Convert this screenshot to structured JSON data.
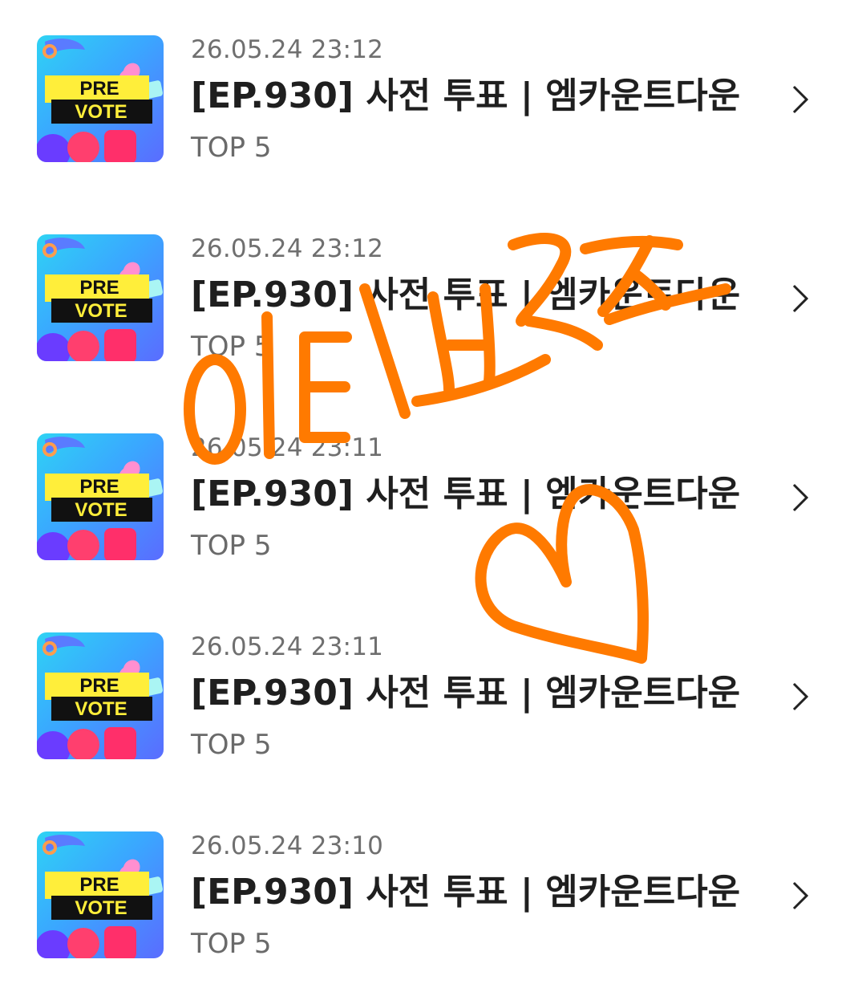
{
  "items": [
    {
      "date": "26.05.24 23:12",
      "title": "[EP.930] 사전 투표 | 엠카운트다운",
      "subtitle": "TOP 5",
      "thumbnail": {
        "line1": "PRE",
        "line2": "VOTE"
      }
    },
    {
      "date": "26.05.24 23:12",
      "title": "[EP.930] 사전 투표 | 엠카운트다운",
      "subtitle": "TOP 5",
      "thumbnail": {
        "line1": "PRE",
        "line2": "VOTE"
      }
    },
    {
      "date": "26.05.24 23:11",
      "title": "[EP.930] 사전 투표 | 엠카운트다운",
      "subtitle": "TOP 5",
      "thumbnail": {
        "line1": "PRE",
        "line2": "VOTE"
      }
    },
    {
      "date": "26.05.24 23:11",
      "title": "[EP.930] 사전 투표 | 엠카운트다운",
      "subtitle": "TOP 5",
      "thumbnail": {
        "line1": "PRE",
        "line2": "VOTE"
      }
    },
    {
      "date": "26.05.24 23:10",
      "title": "[EP.930] 사전 투표 | 엠카운트다운",
      "subtitle": "TOP 5",
      "thumbnail": {
        "line1": "PRE",
        "line2": "VOTE"
      }
    }
  ],
  "overlay": {
    "handwriting": "인티브리즈",
    "drawing": "heart",
    "color": "#ff7a00"
  },
  "icons": {
    "chevron": "chevron-right-icon"
  }
}
